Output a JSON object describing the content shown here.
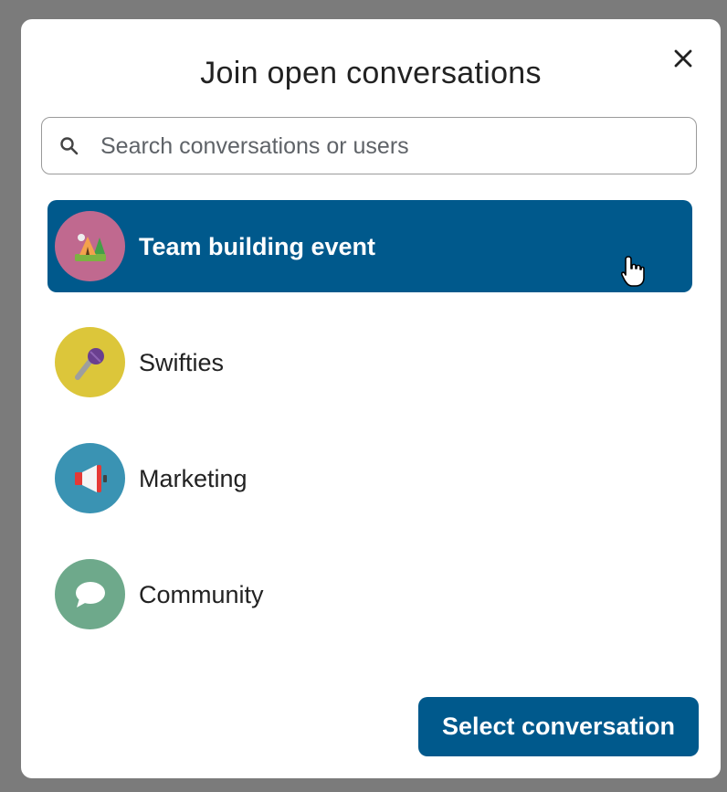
{
  "dialog": {
    "title": "Join open conversations",
    "close_icon": "close-icon"
  },
  "search": {
    "placeholder": "Search conversations or users",
    "value": "",
    "icon": "search-icon"
  },
  "conversations": [
    {
      "label": "Team building event",
      "icon": "camping-tent-icon",
      "avatar_color": "#c0698f",
      "selected": true
    },
    {
      "label": "Swifties",
      "icon": "microphone-icon",
      "avatar_color": "#dcc63a",
      "selected": false
    },
    {
      "label": "Marketing",
      "icon": "megaphone-icon",
      "avatar_color": "#3a93b3",
      "selected": false
    },
    {
      "label": "Community",
      "icon": "speech-bubble-icon",
      "avatar_color": "#6ea98b",
      "selected": false
    }
  ],
  "footer": {
    "select_button_label": "Select conversation"
  },
  "colors": {
    "accent": "#00598c",
    "overlay": "#7b7b7b"
  }
}
